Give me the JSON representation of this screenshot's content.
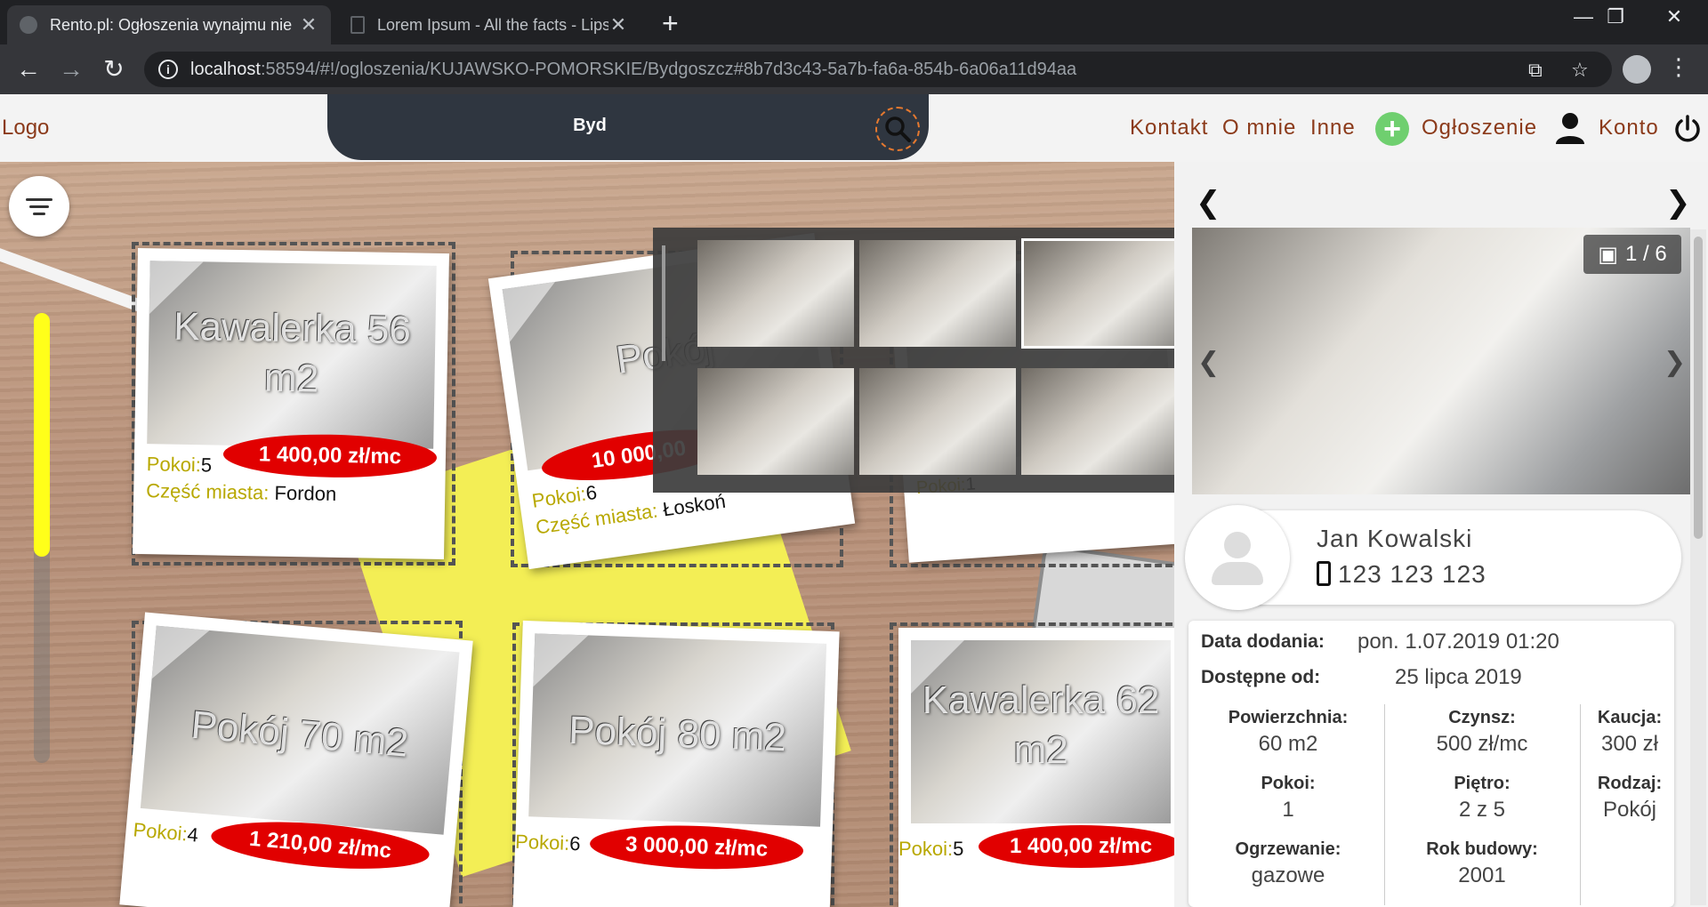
{
  "browser": {
    "tabs": [
      {
        "title": "Rento.pl: Ogłoszenia wynajmu nie",
        "close": "✕"
      },
      {
        "title": "Lorem Ipsum - All the facts - Lips",
        "close": "✕"
      }
    ],
    "new_tab": "+",
    "window_controls": {
      "minimize": "—",
      "maximize": "❐",
      "close": "✕"
    },
    "nav": {
      "back": "←",
      "forward": "→",
      "reload": "↻"
    },
    "url_host": "localhost",
    "url_rest": ":58594/#!/ogloszenia/KUJAWSKO-POMORSKIE/Bydgoszcz#8b7d3c43-5a7b-fa6a-854b-6a06a11d94aa"
  },
  "header": {
    "logo": "Logo",
    "search_query": "Byd",
    "menu": {
      "contact": "Kontakt",
      "about": "O mnie",
      "other": "Inne",
      "listing": "Ogłoszenie",
      "account": "Konto"
    },
    "plus": "+"
  },
  "listings": [
    {
      "title": "Kawalerka 56 m2",
      "price": "1 400,00 zł/mc",
      "rooms_label": "Pokoi:",
      "rooms": "5",
      "district_label": "Część miasta:",
      "district": "Fordon"
    },
    {
      "title": "Pokój",
      "price": "10 000,00",
      "rooms_label": "Pokoi:",
      "rooms": "6",
      "district_label": "Część miasta:",
      "district": "Łoskoń"
    },
    {
      "title": "",
      "price": "",
      "rooms_label": "Pokoi:",
      "rooms": "1"
    },
    {
      "title": "Pokój 70 m2",
      "price": "1 210,00 zł/mc",
      "rooms_label": "Pokoi:",
      "rooms": "4"
    },
    {
      "title": "Pokój 80 m2",
      "price": "3 000,00 zł/mc",
      "rooms_label": "Pokoi:",
      "rooms": "6"
    },
    {
      "title": "Kawalerka 62 m2",
      "price": "1 400,00 zł/mc",
      "rooms_label": "Pokoi:",
      "rooms": "5"
    }
  ],
  "detail": {
    "photo_counter": "1 / 6",
    "contact": {
      "name": "Jan Kowalski",
      "phone": "123 123 123"
    },
    "date_added_label": "Data dodania:",
    "date_added": "pon. 1.07.2019 01:20",
    "available_label": "Dostępne od:",
    "available": "25 lipca 2019",
    "area_label": "Powierzchnia:",
    "area": "60 m2",
    "rent_label": "Czynsz:",
    "rent": "500 zł/mc",
    "deposit_label": "Kaucja:",
    "deposit": "300 zł",
    "rooms_label": "Pokoi:",
    "rooms": "1",
    "floor_label": "Piętro:",
    "floor": "2 z 5",
    "type_label": "Rodzaj:",
    "type": "Pokój",
    "heating_label": "Ogrzewanie:",
    "heating": "gazowe",
    "year_label": "Rok budowy:",
    "year": "2001"
  }
}
